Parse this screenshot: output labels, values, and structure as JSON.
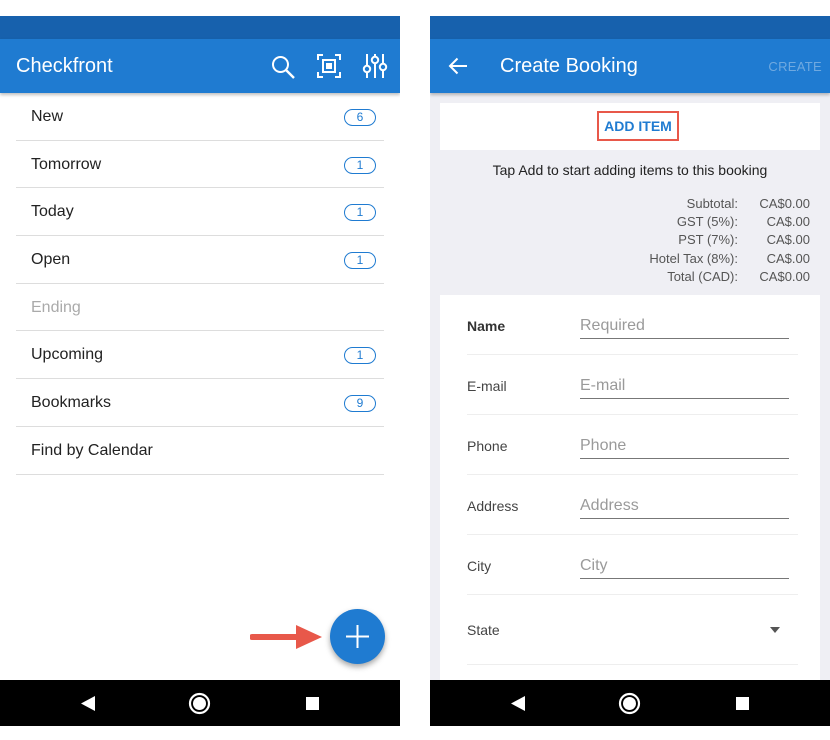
{
  "left_screen": {
    "app_title": "Checkfront",
    "icons": [
      "search-icon",
      "scan-icon",
      "filter-sliders-icon"
    ],
    "list_items": [
      {
        "label": "New",
        "count": "6",
        "enabled": true
      },
      {
        "label": "Tomorrow",
        "count": "1",
        "enabled": true
      },
      {
        "label": "Today",
        "count": "1",
        "enabled": true
      },
      {
        "label": "Open",
        "count": "1",
        "enabled": true
      },
      {
        "label": "Ending",
        "count": "",
        "enabled": false
      },
      {
        "label": "Upcoming",
        "count": "1",
        "enabled": true
      },
      {
        "label": "Bookmarks",
        "count": "9",
        "enabled": true
      },
      {
        "label": "Find by Calendar",
        "count": "",
        "enabled": true
      }
    ],
    "fab_icon": "plus-icon",
    "annotation_color": "#e8584a"
  },
  "right_screen": {
    "app_title": "Create Booking",
    "back_icon": "arrow-left-icon",
    "create_action": "CREATE",
    "add_item_label": "ADD ITEM",
    "hint": "Tap Add to start adding items to this booking",
    "totals": [
      {
        "label": "Subtotal:",
        "value": "CA$0.00"
      },
      {
        "label": "GST (5%):",
        "value": "CA$.00"
      },
      {
        "label": "PST (7%):",
        "value": "CA$.00"
      },
      {
        "label": "Hotel Tax (8%):",
        "value": "CA$.00"
      },
      {
        "label": "Total (CAD):",
        "value": "CA$0.00"
      }
    ],
    "form": {
      "name": {
        "label": "Name",
        "placeholder": "Required"
      },
      "email": {
        "label": "E-mail",
        "placeholder": "E-mail"
      },
      "phone": {
        "label": "Phone",
        "placeholder": "Phone"
      },
      "address": {
        "label": "Address",
        "placeholder": "Address"
      },
      "city": {
        "label": "City",
        "placeholder": "City"
      },
      "state": {
        "label": "State",
        "value": ""
      }
    }
  },
  "nav_icons": [
    "back-triangle-icon",
    "home-circle-icon",
    "recents-square-icon"
  ],
  "colors": {
    "primary": "#1f7bd1",
    "status_bar": "#1761ad",
    "annotation": "#e8584a"
  }
}
